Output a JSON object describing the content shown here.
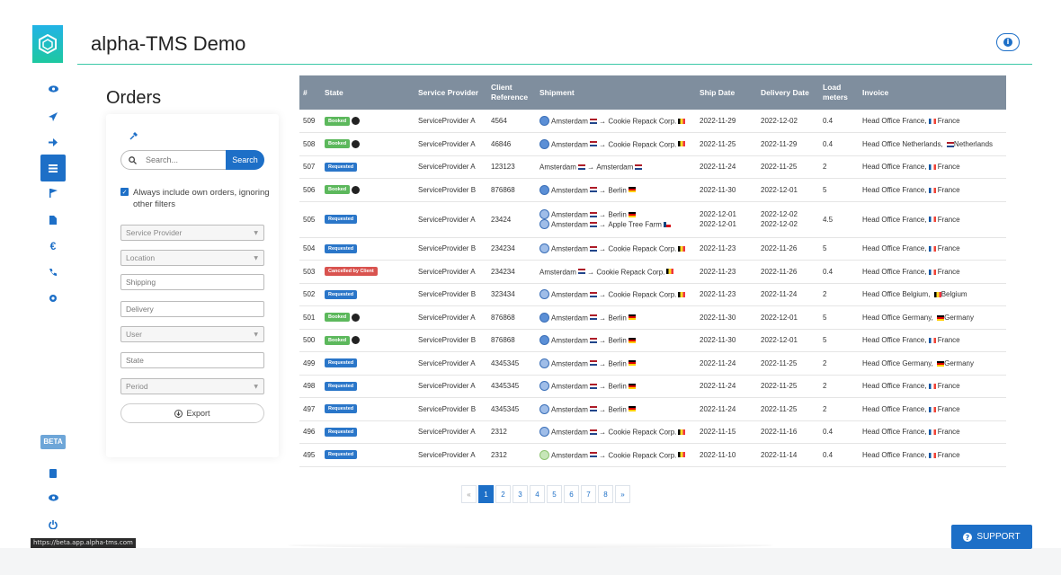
{
  "app": {
    "title": "alpha-TMS Demo",
    "beta": "BETA",
    "status_url": "https://beta.app.alpha-tms.com"
  },
  "rail": {
    "icons": [
      "eye-icon",
      "location-arrow-icon",
      "arrow-right-icon",
      "list-icon",
      "flag-icon",
      "file-icon",
      "euro-icon",
      "phone-icon",
      "gear-icon"
    ],
    "bottom_icons": [
      "book-icon",
      "eye-icon",
      "power-icon"
    ]
  },
  "orders": {
    "title": "Orders",
    "search": {
      "placeholder": "Search...",
      "button": "Search"
    },
    "always_include": "Always include own orders, ignoring other filters",
    "filters": {
      "service_provider": "Service Provider",
      "location": "Location",
      "shipping": "Shipping",
      "delivery": "Delivery",
      "user": "User",
      "state": "State",
      "period": "Period"
    },
    "export": "Export"
  },
  "table": {
    "headers": {
      "num": "#",
      "state": "State",
      "provider": "Service Provider",
      "client_ref_1": "Client",
      "client_ref_2": "Reference",
      "shipment": "Shipment",
      "ship_date": "Ship Date",
      "delivery_date": "Delivery Date",
      "load_1": "Load",
      "load_2": "meters",
      "invoice": "Invoice"
    },
    "rows": [
      {
        "num": "509",
        "state": "Booked",
        "provider": "ServiceProvider A",
        "ref": "4564",
        "ship1": "Amsterdam",
        "dest1": "Cookie Repack Corp.",
        "ship_date": "2022-11-29",
        "delivery_date": "2022-12-02",
        "load": "0.4",
        "invoice": "Head Office France,",
        "invoice_country": "France"
      },
      {
        "num": "508",
        "state": "Booked",
        "provider": "ServiceProvider A",
        "ref": "46846",
        "ship1": "Amsterdam",
        "dest1": "Cookie Repack Corp.",
        "ship_date": "2022-11-25",
        "delivery_date": "2022-11-29",
        "load": "0.4",
        "invoice": "Head Office Netherlands,",
        "invoice_country": "Netherlands"
      },
      {
        "num": "507",
        "state": "Requested",
        "provider": "ServiceProvider A",
        "ref": "123123",
        "ship1": "Amsterdam",
        "dest1": "Amsterdam",
        "ship_date": "2022-11-24",
        "delivery_date": "2022-11-25",
        "load": "2",
        "invoice": "Head Office France,",
        "invoice_country": "France"
      },
      {
        "num": "506",
        "state": "Booked",
        "provider": "ServiceProvider B",
        "ref": "876868",
        "ship1": "Amsterdam",
        "dest1": "Berlin",
        "ship_date": "2022-11-30",
        "delivery_date": "2022-12-01",
        "load": "5",
        "invoice": "Head Office France,",
        "invoice_country": "France"
      },
      {
        "num": "505",
        "state": "Requested",
        "provider": "ServiceProvider A",
        "ref": "23424",
        "ship1": "Amsterdam",
        "dest1": "Berlin",
        "ship2": "Amsterdam",
        "dest2": "Apple Tree Farm",
        "ship_date": "2022-12-01",
        "ship_date2": "2022-12-01",
        "delivery_date": "2022-12-02",
        "delivery_date2": "2022-12-02",
        "load": "4.5",
        "invoice": "Head Office France,",
        "invoice_country": "France"
      },
      {
        "num": "504",
        "state": "Requested",
        "provider": "ServiceProvider B",
        "ref": "234234",
        "ship1": "Amsterdam",
        "dest1": "Cookie Repack Corp.",
        "ship_date": "2022-11-23",
        "delivery_date": "2022-11-26",
        "load": "5",
        "invoice": "Head Office France,",
        "invoice_country": "France"
      },
      {
        "num": "503",
        "state": "Cancelled by Client",
        "provider": "ServiceProvider A",
        "ref": "234234",
        "ship1": "Amsterdam",
        "dest1": "Cookie Repack Corp.",
        "ship_date": "2022-11-23",
        "delivery_date": "2022-11-26",
        "load": "0.4",
        "invoice": "Head Office France,",
        "invoice_country": "France"
      },
      {
        "num": "502",
        "state": "Requested",
        "provider": "ServiceProvider B",
        "ref": "323434",
        "ship1": "Amsterdam",
        "dest1": "Cookie Repack Corp.",
        "ship_date": "2022-11-23",
        "delivery_date": "2022-11-24",
        "load": "2",
        "invoice": "Head Office Belgium,",
        "invoice_country": "Belgium"
      },
      {
        "num": "501",
        "state": "Booked",
        "provider": "ServiceProvider A",
        "ref": "876868",
        "ship1": "Amsterdam",
        "dest1": "Berlin",
        "ship_date": "2022-11-30",
        "delivery_date": "2022-12-01",
        "load": "5",
        "invoice": "Head Office Germany,",
        "invoice_country": "Germany"
      },
      {
        "num": "500",
        "state": "Booked",
        "provider": "ServiceProvider B",
        "ref": "876868",
        "ship1": "Amsterdam",
        "dest1": "Berlin",
        "ship_date": "2022-11-30",
        "delivery_date": "2022-12-01",
        "load": "5",
        "invoice": "Head Office France,",
        "invoice_country": "France"
      },
      {
        "num": "499",
        "state": "Requested",
        "provider": "ServiceProvider A",
        "ref": "4345345",
        "ship1": "Amsterdam",
        "dest1": "Berlin",
        "ship_date": "2022-11-24",
        "delivery_date": "2022-11-25",
        "load": "2",
        "invoice": "Head Office Germany,",
        "invoice_country": "Germany"
      },
      {
        "num": "498",
        "state": "Requested",
        "provider": "ServiceProvider A",
        "ref": "4345345",
        "ship1": "Amsterdam",
        "dest1": "Berlin",
        "ship_date": "2022-11-24",
        "delivery_date": "2022-11-25",
        "load": "2",
        "invoice": "Head Office France,",
        "invoice_country": "France"
      },
      {
        "num": "497",
        "state": "Requested",
        "provider": "ServiceProvider B",
        "ref": "4345345",
        "ship1": "Amsterdam",
        "dest1": "Berlin",
        "ship_date": "2022-11-24",
        "delivery_date": "2022-11-25",
        "load": "2",
        "invoice": "Head Office France,",
        "invoice_country": "France"
      },
      {
        "num": "496",
        "state": "Requested",
        "provider": "ServiceProvider A",
        "ref": "2312",
        "ship1": "Amsterdam",
        "dest1": "Cookie Repack Corp.",
        "ship_date": "2022-11-15",
        "delivery_date": "2022-11-16",
        "load": "0.4",
        "invoice": "Head Office France,",
        "invoice_country": "France"
      },
      {
        "num": "495",
        "state": "Requested",
        "provider": "ServiceProvider A",
        "ref": "2312",
        "ship1": "Amsterdam",
        "dest1": "Cookie Repack Corp.",
        "ship_date": "2022-11-10",
        "delivery_date": "2022-11-14",
        "load": "0.4",
        "invoice": "Head Office France,",
        "invoice_country": "France"
      }
    ]
  },
  "pagination": {
    "prev": "«",
    "pages": [
      "1",
      "2",
      "3",
      "4",
      "5",
      "6",
      "7",
      "8"
    ],
    "next": "»",
    "current": "1"
  },
  "support": {
    "label": "SUPPORT"
  },
  "colors": {
    "primary": "#1d6fc7",
    "booked": "#5cb85c",
    "requested": "#2a76c9",
    "cancelled": "#d9534f",
    "header": "#7f8e9e",
    "accent_line": "#3cc8a8"
  }
}
